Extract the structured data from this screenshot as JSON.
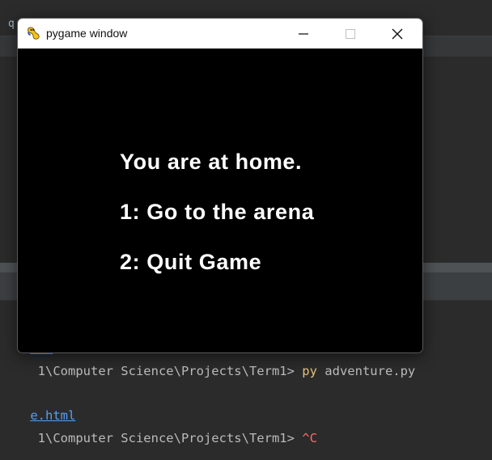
{
  "ide": {
    "top_label": "q",
    "terminal_lines": [
      {
        "link": "e.h",
        "text": "",
        "cmd": "",
        "args": ""
      },
      {
        "link": "",
        "text": " 1\\Computer Science\\Projects\\Term1> ",
        "cmd": "py",
        "args": " adventure.py"
      },
      {
        "link": "e.html",
        "text": "",
        "cmd": "",
        "args": ""
      },
      {
        "link": "",
        "text": " 1\\Computer Science\\Projects\\Term1> ",
        "cmd": "^C",
        "args": ""
      }
    ]
  },
  "window": {
    "title": "pygame window",
    "icon": "pygame-snake-icon",
    "controls": [
      "minimize-icon",
      "maximize-icon",
      "close-icon"
    ]
  },
  "game": {
    "lines": [
      "You are at home.",
      "1: Go to the arena",
      "2: Quit Game"
    ]
  },
  "colors": {
    "ide_background": "#2b2b2b",
    "terminal_link": "#589df6",
    "terminal_command": "#e5c07b",
    "terminal_interrupt": "#ff6b68",
    "game_background": "#000000",
    "game_text": "#ffffff"
  }
}
